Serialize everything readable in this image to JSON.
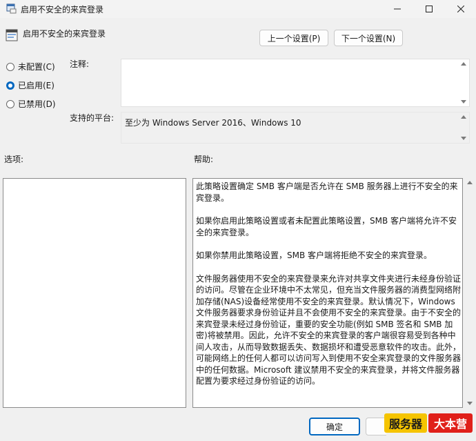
{
  "window": {
    "title": "启用不安全的来宾登录"
  },
  "header": {
    "title": "启用不安全的来宾登录"
  },
  "nav": {
    "prev_label": "上一个设置(P)",
    "next_label": "下一个设置(N)"
  },
  "state": {
    "options": [
      {
        "label": "未配置(C)",
        "checked": false
      },
      {
        "label": "已启用(E)",
        "checked": true
      },
      {
        "label": "已禁用(D)",
        "checked": false
      }
    ]
  },
  "comment": {
    "label": "注释:",
    "value": ""
  },
  "platform": {
    "label": "支持的平台:",
    "value": "至少为 Windows Server 2016、Windows 10"
  },
  "options_section": {
    "label": "选项:"
  },
  "help_section": {
    "label": "帮助:",
    "paragraphs": [
      "此策略设置确定 SMB 客户端是否允许在 SMB 服务器上进行不安全的来宾登录。",
      "如果你启用此策略设置或者未配置此策略设置，SMB 客户端将允许不安全的来宾登录。",
      "如果你禁用此策略设置，SMB 客户端将拒绝不安全的来宾登录。",
      "文件服务器使用不安全的来宾登录来允许对共享文件夹进行未经身份验证的访问。尽管在企业环境中不太常见，但充当文件服务器的消费型网络附加存储(NAS)设备经常使用不安全的来宾登录。默认情况下，Windows 文件服务器要求身份验证并且不会使用不安全的来宾登录。由于不安全的来宾登录未经过身份验证，重要的安全功能(例如 SMB 签名和 SMB 加密)将被禁用。因此，允许不安全的来宾登录的客户端很容易受到各种中间人攻击，从而导致数据丢失、数据损坏和遭受恶意软件的攻击。此外，可能网络上的任何人都可以访问写入到使用不安全来宾登录的文件服务器中的任何数据。Microsoft 建议禁用不安全的来宾登录，并将文件服务器配置为要求经过身份验证的访问。"
    ]
  },
  "footer": {
    "ok_label": "确定"
  },
  "watermark": {
    "part1": "服务器",
    "part2": "大本营"
  }
}
